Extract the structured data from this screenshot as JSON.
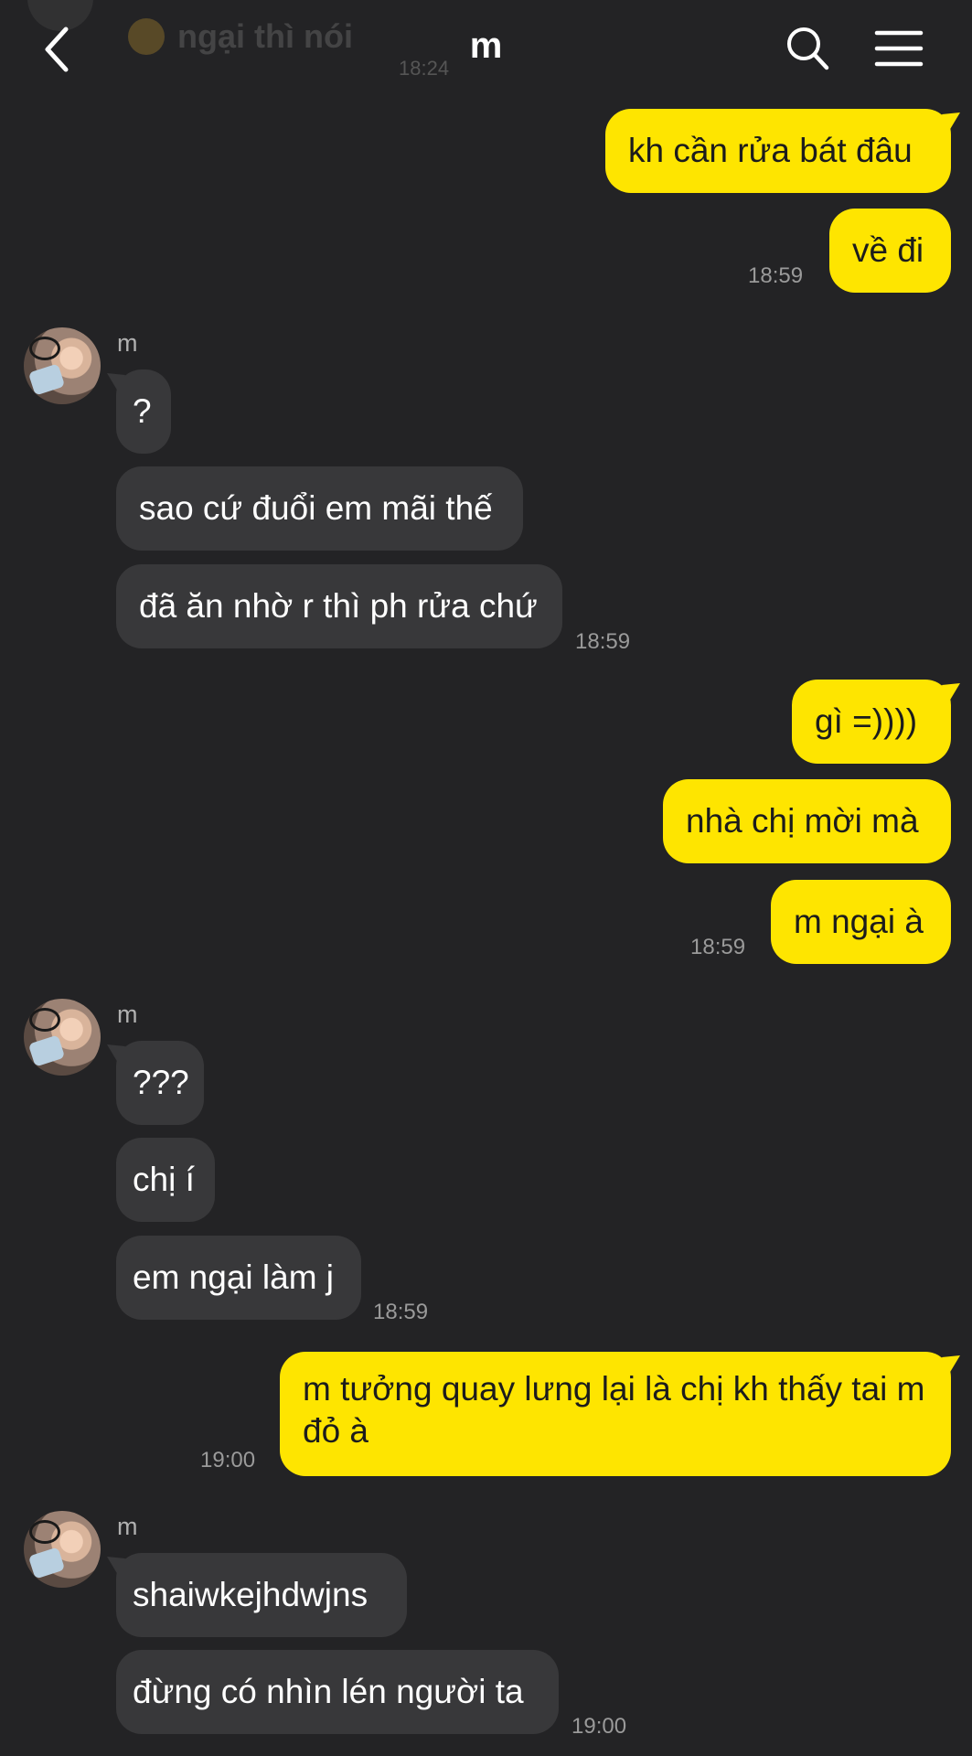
{
  "header": {
    "title": "m",
    "ghost_preview": "ngại thì nói",
    "ghost_time": "18:24"
  },
  "colors": {
    "background": "#232325",
    "outgoing": "#fee500",
    "incoming": "#38383a",
    "time": "#9a9a9a"
  },
  "icons": [
    "back-icon",
    "search-icon",
    "menu-icon"
  ],
  "messages": {
    "out1": {
      "text": "kh cần rửa bát đâu"
    },
    "out2": {
      "text": "về đi",
      "time": "18:59"
    },
    "group1": {
      "sender": "m"
    },
    "in1": {
      "text": "?"
    },
    "in2": {
      "text": "sao cứ đuổi em mãi thế"
    },
    "in3": {
      "text": "đã ăn nhờ r thì ph rửa chứ",
      "time": "18:59"
    },
    "out3": {
      "text": "gì =))))"
    },
    "out4": {
      "text": "nhà chị mời mà"
    },
    "out5": {
      "text": "m ngại à",
      "time": "18:59"
    },
    "group2": {
      "sender": "m"
    },
    "in4": {
      "text": "???"
    },
    "in5": {
      "text": "chị í"
    },
    "in6": {
      "text": "em ngại làm j",
      "time": "18:59"
    },
    "out6": {
      "text": "m tưởng quay lưng lại là chị kh thấy tai m đỏ à",
      "time": "19:00"
    },
    "group3": {
      "sender": "m"
    },
    "in7": {
      "text": "shaiwkejhdwjns"
    },
    "in8": {
      "text": "đừng có nhìn lén người ta",
      "time": "19:00"
    }
  }
}
